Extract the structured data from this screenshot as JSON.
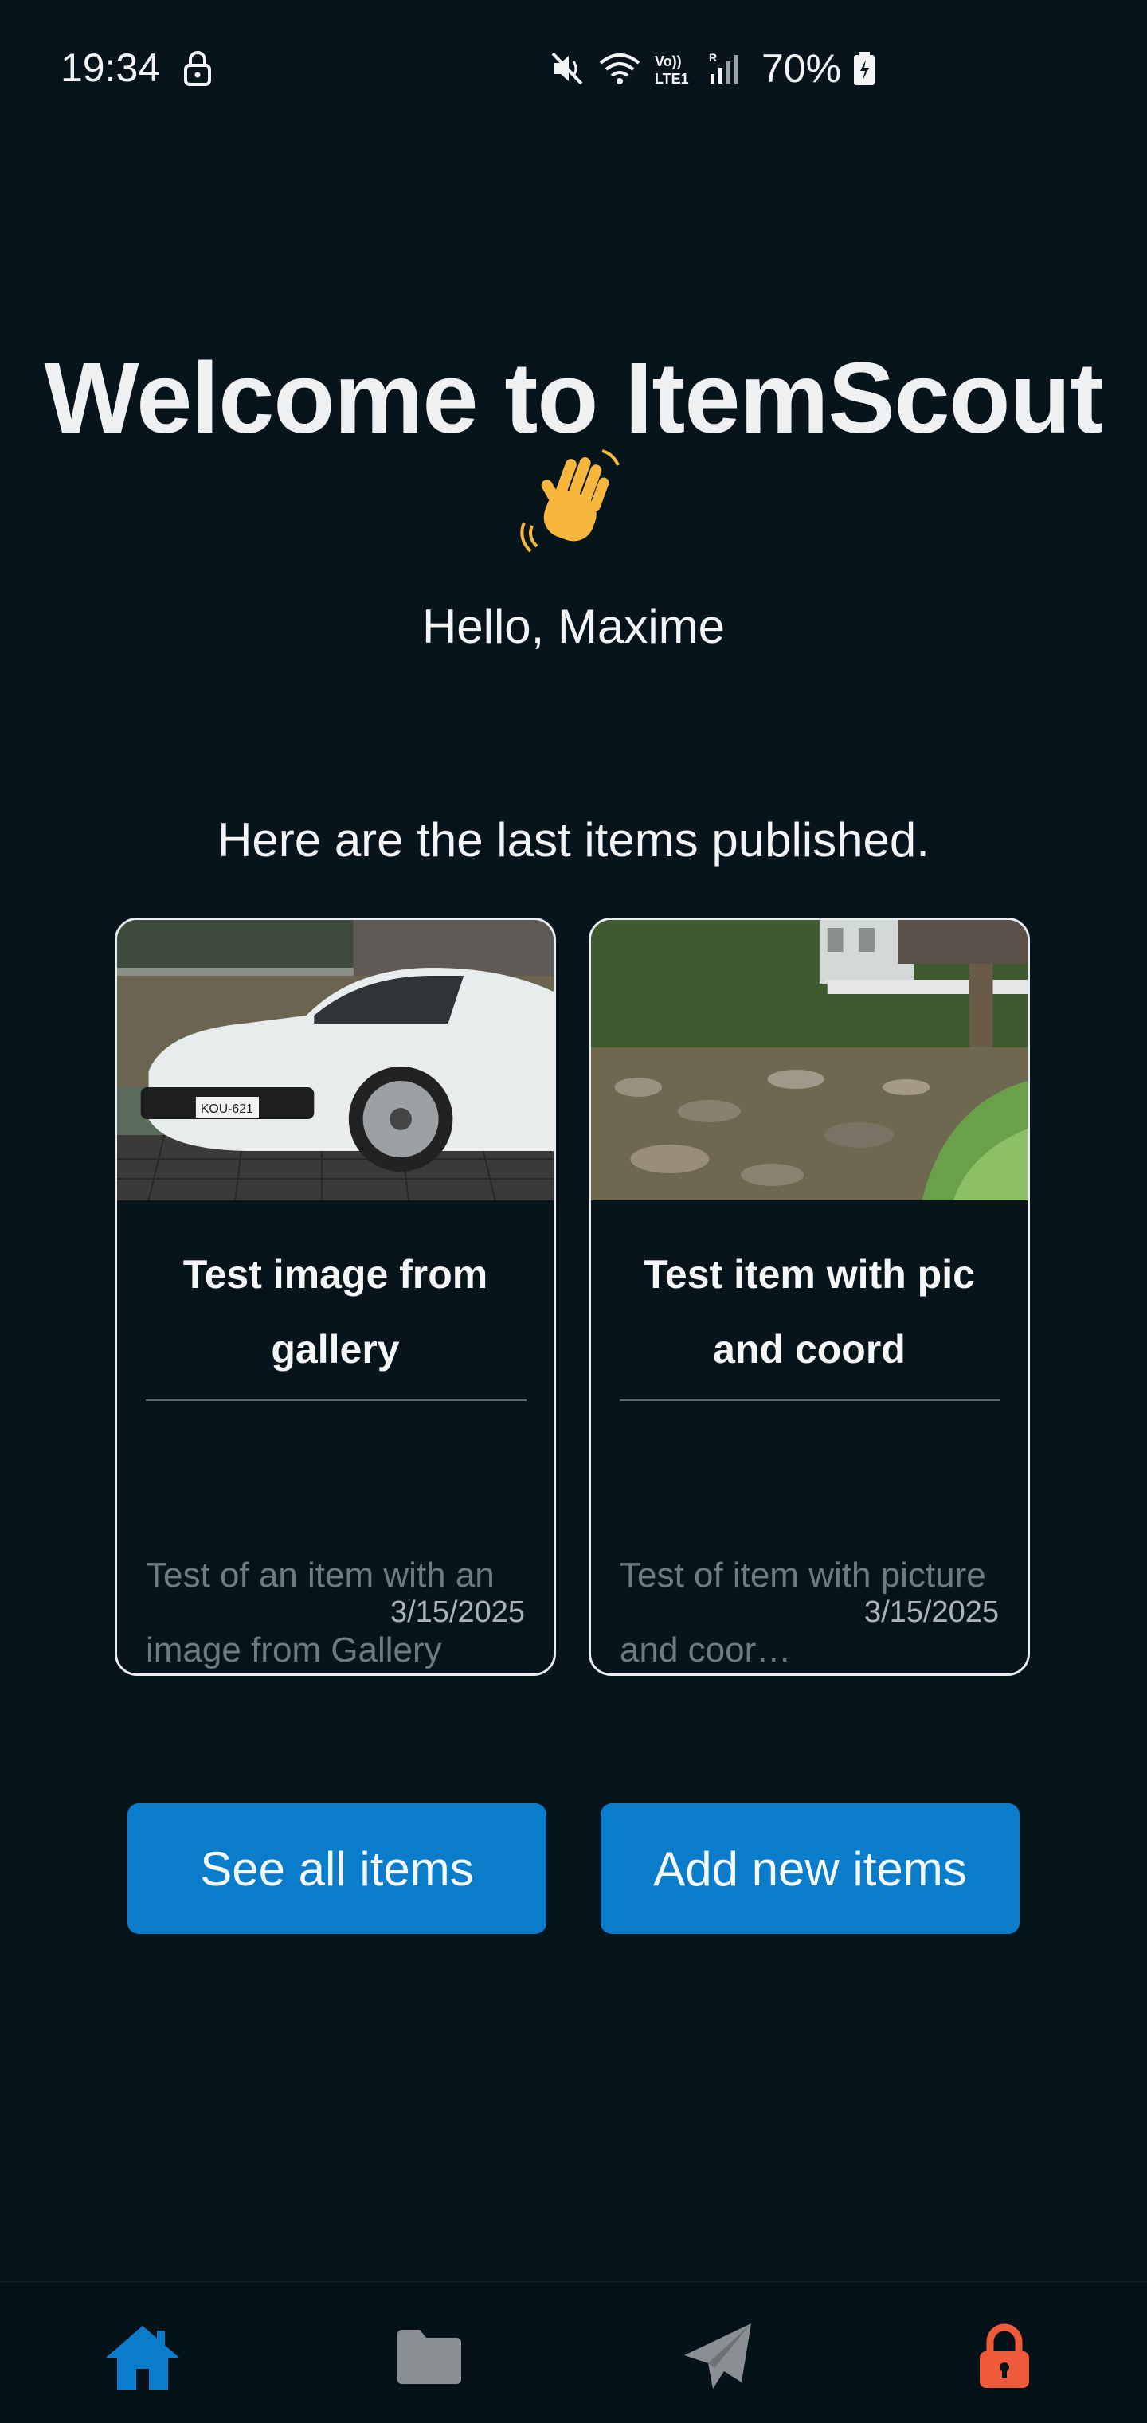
{
  "status_bar": {
    "time": "19:34",
    "battery": "70%",
    "icons": [
      "lock-icon",
      "mute-icon",
      "wifi-icon",
      "volte-icon",
      "signal-icon",
      "battery-icon"
    ]
  },
  "header": {
    "title": "Welcome to ItemScout",
    "greeting": "Hello, Maxime"
  },
  "main": {
    "subtitle": "Here are the last items published.",
    "items": [
      {
        "title": "Test image from gallery",
        "description": "Test of an item with an image from Gallery",
        "date": "3/15/2025",
        "image": "white-sports-car-photo"
      },
      {
        "title": "Test item with pic and coord",
        "description": "Test of item with picture and coor…",
        "date": "3/15/2025",
        "image": "river-and-bridge-photo"
      }
    ],
    "buttons": {
      "see_all": "See all items",
      "add_new": "Add new items"
    }
  },
  "navbar": {
    "items": [
      "home-icon",
      "folder-icon",
      "send-icon",
      "lock-icon"
    ],
    "active_color": "#0a7ccc",
    "inactive_color": "#8a8f93",
    "lock_color": "#ef5b3a"
  },
  "colors": {
    "background": "#07141c",
    "accent": "#0a7ccc"
  }
}
